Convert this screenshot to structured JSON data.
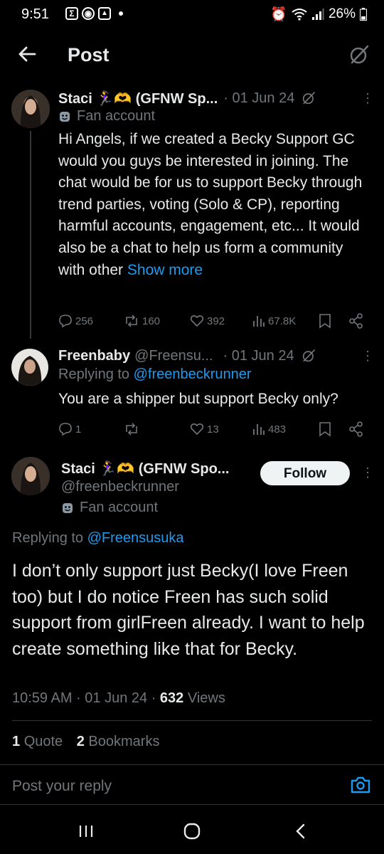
{
  "status_bar": {
    "time": "9:51",
    "battery": "26%"
  },
  "header": {
    "title": "Post"
  },
  "tweet1": {
    "name": "Staci 🏃‍♀️🫶 (GFNW Sp...",
    "date": "· 01 Jun 24",
    "label": "Fan account",
    "text": "Hi Angels, if we created a Becky Support GC would you guys be interested in joining. The chat would be for us to support Becky through trend parties, voting (Solo & CP), reporting harmful accounts, engagement, etc... It would also be a chat to help us form a community with other",
    "show_more": "Show more",
    "stats": {
      "replies": "256",
      "reposts": "160",
      "likes": "392",
      "views": "67.8K"
    }
  },
  "tweet2": {
    "name": "Freenbaby",
    "handle": "@Freensu...",
    "date": "· 01 Jun 24",
    "replying_prefix": "Replying to",
    "replying_to": "@freenbeckrunner",
    "text": "You are a shipper but support Becky only?",
    "stats": {
      "replies": "1",
      "likes": "13",
      "views": "483"
    }
  },
  "main_tweet": {
    "name": "Staci 🏃‍♀️🫶 (GFNW Spo...",
    "handle": "@freenbeckrunner",
    "label": "Fan account",
    "follow_label": "Follow",
    "replying_prefix": "Replying to",
    "replying_to": "@Freensusuka",
    "text": "I don’t only support just Becky(I love Freen too) but I do notice Freen has such solid support from girlFreen already. I want to help create something like that for Becky.",
    "time": "10:59 AM · 01 Jun 24 ·",
    "views_count": "632",
    "views_label": "Views",
    "quotes_count": "1",
    "quotes_label": "Quote",
    "bookmarks_count": "2",
    "bookmarks_label": "Bookmarks"
  },
  "reply_bar": {
    "placeholder": "Post your reply"
  },
  "colors": {
    "background": "#000000",
    "accent": "#1d9bf0",
    "secondary_text": "#71767b",
    "primary_text": "#e7e9ea"
  }
}
